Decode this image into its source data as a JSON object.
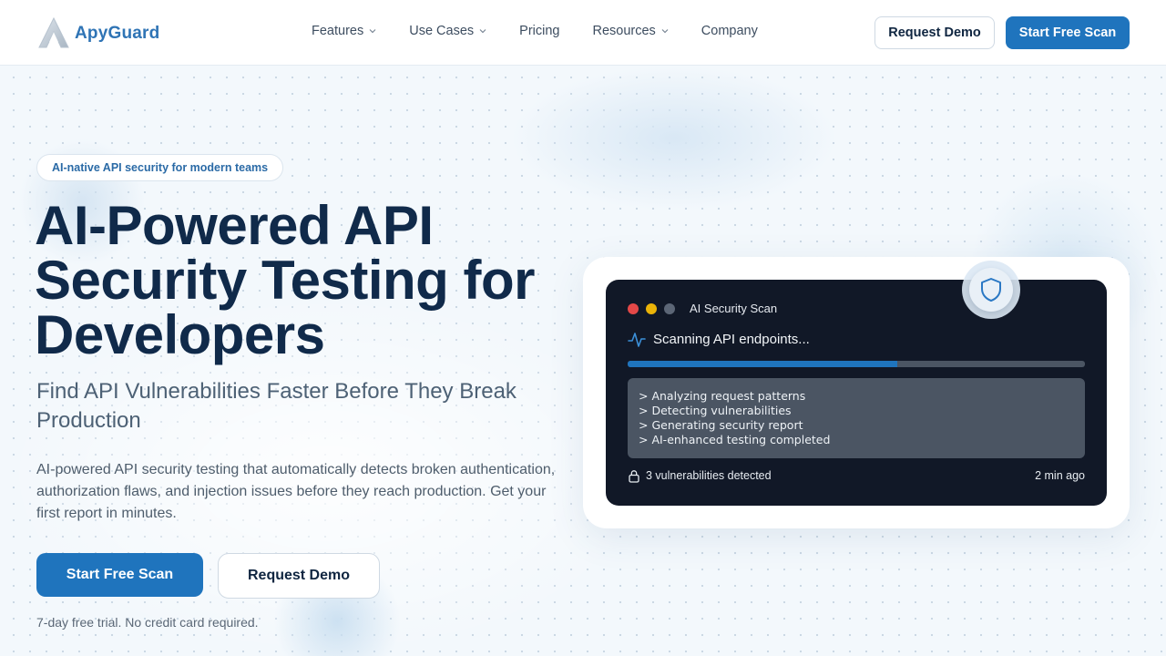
{
  "brand": {
    "name": "ApyGuard",
    "logo_icon": "apyguard-logo-icon",
    "color": "#2f74b5"
  },
  "nav": {
    "items": [
      {
        "label": "Features",
        "has_dropdown": true
      },
      {
        "label": "Use Cases",
        "has_dropdown": true
      },
      {
        "label": "Pricing",
        "has_dropdown": false
      },
      {
        "label": "Resources",
        "has_dropdown": true
      },
      {
        "label": "Company",
        "has_dropdown": false
      }
    ],
    "request_demo": "Request Demo",
    "start_scan": "Start Free Scan"
  },
  "hero": {
    "badge": "AI-native API security for modern teams",
    "headline": "AI-Powered API Security Testing for Developers",
    "subhead": "Find API Vulnerabilities Faster Before They Break Production",
    "description": "AI-powered API security testing that automatically detects broken authentication, authorization flaws, and injection issues before they reach production. Get your first report in minutes.",
    "primary_cta": "Start Free Scan",
    "secondary_cta": "Request Demo",
    "trial_note": "7-day free trial. No credit card required."
  },
  "scan_card": {
    "title": "AI Security Scan",
    "status": "Scanning API endpoints...",
    "progress_percent": 59,
    "log": [
      "> Analyzing request patterns",
      "> Detecting vulnerabilities",
      "> Generating security report",
      "> AI-enhanced testing completed"
    ],
    "vulnerabilities": "3 vulnerabilities detected",
    "time": "2 min ago"
  },
  "colors": {
    "accent": "#1f74bd",
    "dark_text": "#102a4a",
    "terminal_bg": "#111827",
    "dot_red": "#e44848",
    "dot_yellow": "#eab308"
  }
}
